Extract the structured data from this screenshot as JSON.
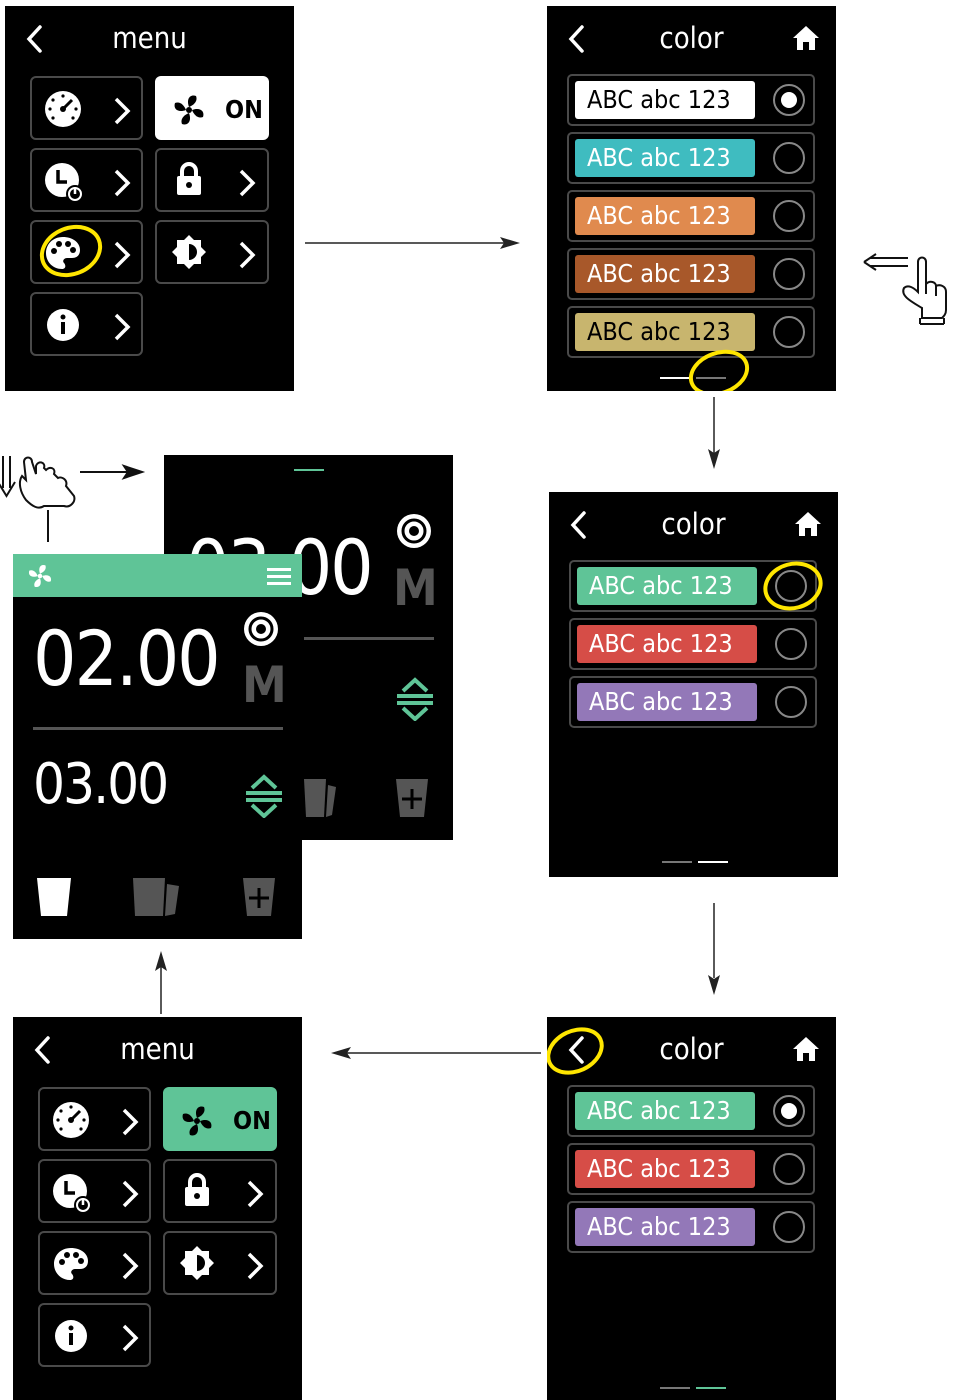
{
  "menu_screen": {
    "title": "menu",
    "on_label": "ON"
  },
  "color_screen": {
    "title": "color",
    "row_label": "ABC abc 123",
    "page1_colors": [
      "#ffffff",
      "#3fbcc0",
      "#e08a4e",
      "#a8582a",
      "#c8b56e"
    ],
    "page2_colors": [
      "#5fc497",
      "#d64d47",
      "#9378b8"
    ]
  },
  "home_screen": {
    "time_main": "02.00",
    "time_second": "03.00",
    "mode_letter": "M",
    "back_time": "03.00"
  },
  "colors": {
    "accent_green": "#5fc497",
    "highlight_ring": "#ffe600"
  }
}
